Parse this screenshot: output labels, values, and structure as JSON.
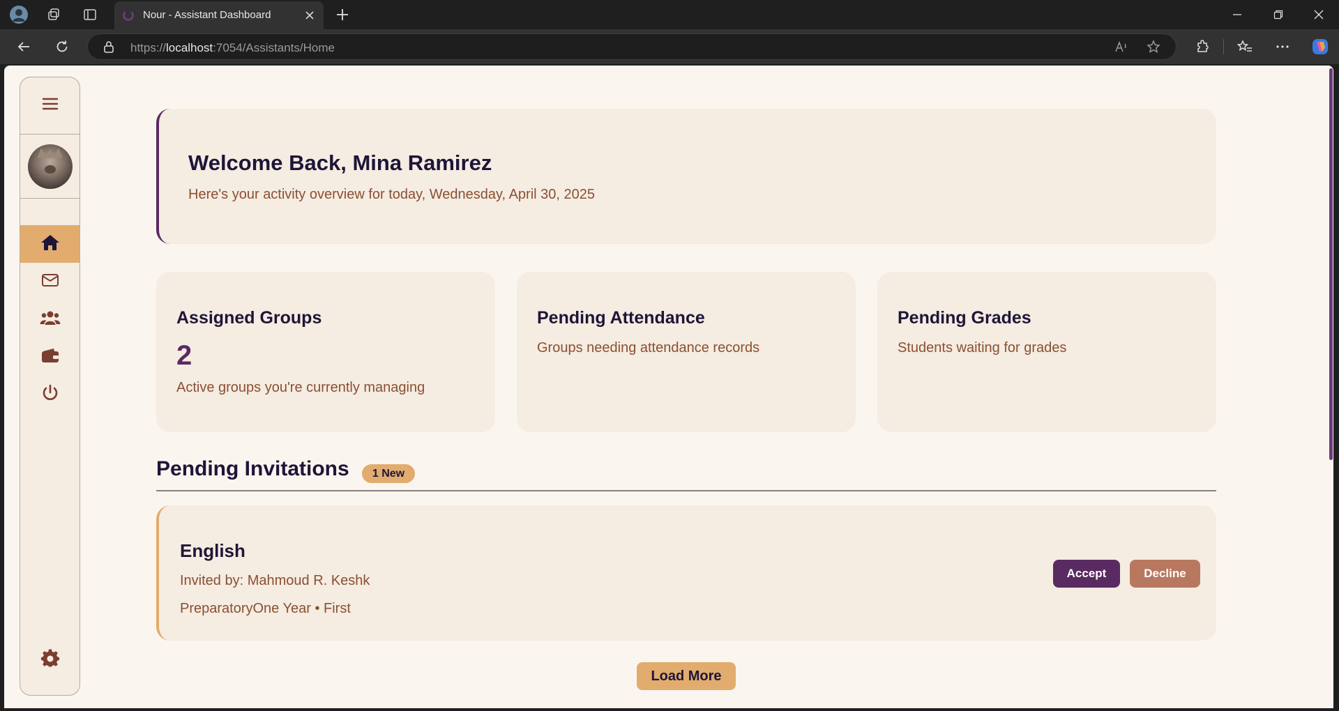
{
  "browser": {
    "tab_title": "Nour - Assistant Dashboard",
    "url_scheme": "https://",
    "url_host": "localhost",
    "url_rest": ":7054/Assistants/Home"
  },
  "sidebar": {
    "items": [
      {
        "name": "home",
        "icon": "home-icon",
        "active": true
      },
      {
        "name": "messages",
        "icon": "envelope-icon",
        "active": false
      },
      {
        "name": "groups",
        "icon": "users-icon",
        "active": false
      },
      {
        "name": "wallet",
        "icon": "wallet-icon",
        "active": false
      },
      {
        "name": "logout",
        "icon": "power-icon",
        "active": false
      }
    ],
    "settings_icon": "gear-icon"
  },
  "welcome": {
    "title": "Welcome Back, Mina Ramirez",
    "subtitle": "Here's your activity overview for today, Wednesday, April 30, 2025"
  },
  "cards": [
    {
      "title": "Assigned Groups",
      "value": "2",
      "desc": "Active groups you're currently managing"
    },
    {
      "title": "Pending Attendance",
      "desc": "Groups needing attendance records"
    },
    {
      "title": "Pending Grades",
      "desc": "Students waiting for grades"
    }
  ],
  "invitations": {
    "title": "Pending Invitations",
    "badge": "1 New",
    "items": [
      {
        "subject": "English",
        "invited_by": "Invited by: Mahmoud R. Keshk",
        "meta": "PreparatoryOne Year • First",
        "accept_label": "Accept",
        "decline_label": "Decline"
      }
    ],
    "load_more_label": "Load More"
  },
  "colors": {
    "accent_purple": "#5a2a62",
    "accent_orange": "#e2ac6e",
    "page_bg": "#faf6ef",
    "card_bg": "#f5ece2",
    "text_dark": "#1e1538",
    "text_brown": "#8a5030",
    "decline": "#b87860"
  }
}
